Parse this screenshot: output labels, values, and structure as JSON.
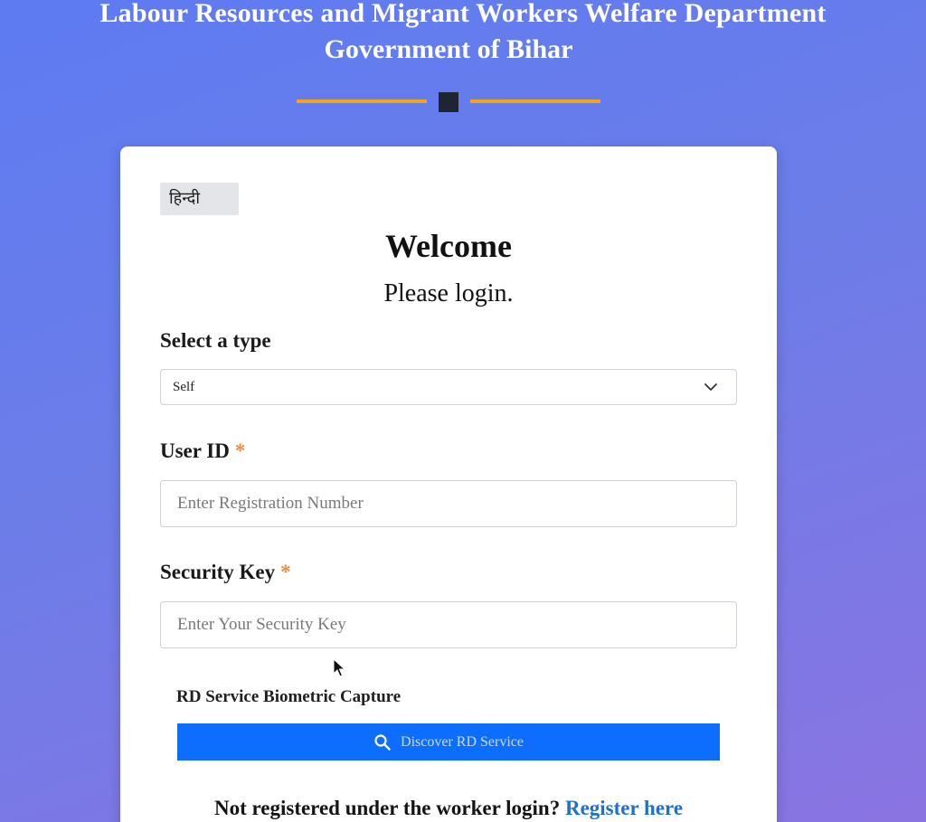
{
  "header": {
    "title": "Labour Resources and Migrant Workers Welfare Department",
    "subtitle": "Government of Bihar"
  },
  "colors": {
    "accent_line": "#f2a51a",
    "primary_button": "#0d6efd",
    "link": "#1f6fd1",
    "required": "#f08a3c"
  },
  "login": {
    "language_button": "हिन्दी",
    "welcome": "Welcome",
    "subtitle": "Please login.",
    "type_label": "Select a type",
    "type_selected": "Self",
    "user_id_label": "User ID",
    "user_id_placeholder": "Enter Registration Number",
    "security_key_label": "Security Key",
    "security_key_placeholder": "Enter Your Security Key",
    "required_mark": "*",
    "rd_label": "RD Service Biometric Capture",
    "rd_button": "Discover RD Service",
    "rd_button_icon": "search-icon",
    "not_registered": "Not registered under the worker login?",
    "register_link": "Register here"
  }
}
